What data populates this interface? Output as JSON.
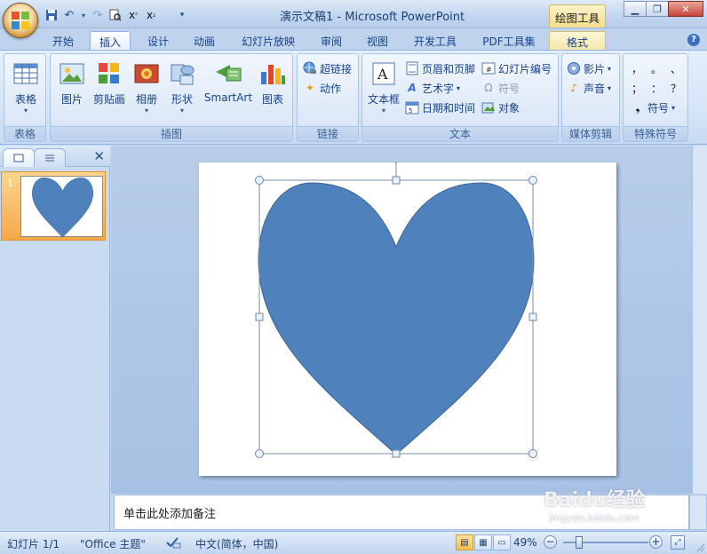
{
  "window": {
    "title": "演示文稿1 - Microsoft PowerPoint",
    "context_tool": "绘图工具"
  },
  "qat": {
    "icons": [
      "save-icon",
      "undo-icon",
      "redo-icon",
      "print-preview-icon",
      "superscript-icon",
      "subscript-icon",
      "customize-icon"
    ]
  },
  "tabs": [
    {
      "label": "开始"
    },
    {
      "label": "插入"
    },
    {
      "label": "设计"
    },
    {
      "label": "动画"
    },
    {
      "label": "幻灯片放映"
    },
    {
      "label": "审阅"
    },
    {
      "label": "视图"
    },
    {
      "label": "开发工具"
    },
    {
      "label": "PDF工具集"
    },
    {
      "label": "格式"
    }
  ],
  "ribbon": {
    "table_group": {
      "label": "表格",
      "table": "表格"
    },
    "illustrations_group": {
      "label": "插图",
      "picture": "图片",
      "clipart": "剪贴画",
      "album": "相册",
      "shapes": "形状",
      "smartart": "SmartArt",
      "chart": "图表"
    },
    "links_group": {
      "label": "链接",
      "hyperlink": "超链接",
      "action": "动作"
    },
    "text_group": {
      "label": "文本",
      "textbox": "文本框",
      "header_footer": "页眉和页脚",
      "wordart": "艺术字",
      "datetime": "日期和时间",
      "slide_number": "幻灯片编号",
      "symbol": "符号",
      "object": "对象"
    },
    "media_group": {
      "label": "媒体剪辑",
      "movie": "影片",
      "sound": "声音"
    },
    "special_group": {
      "label": "特殊符号",
      "symbols": [
        "，",
        "。",
        "、",
        "；",
        "：",
        "？"
      ],
      "symbol_btn": "符号"
    }
  },
  "left_pane": {
    "slide_number": "1"
  },
  "notes": {
    "placeholder": "单击此处添加备注"
  },
  "status": {
    "slide_info": "幻灯片 1/1",
    "theme": "\"Office 主题\"",
    "language": "中文(简体，中国)",
    "zoom": "49%"
  },
  "watermark": {
    "brand": "Baidu经验",
    "url": "jingyan.baidu.com"
  },
  "colors": {
    "heart_fill": "#4f81bd",
    "heart_stroke": "#3a6596",
    "handle_green": "#7fd14b"
  }
}
